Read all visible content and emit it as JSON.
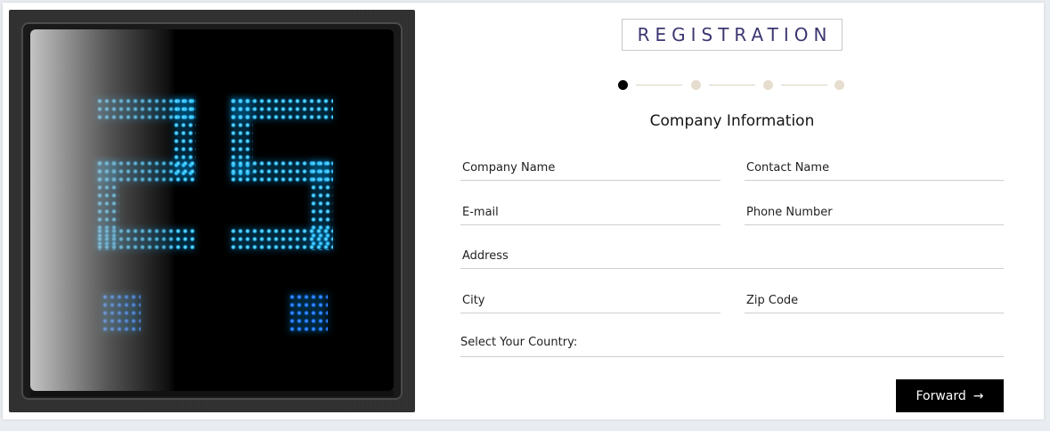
{
  "image": {
    "description_icon": "led-display-image",
    "digits_shown": "25"
  },
  "header": {
    "title": "REGISTRATION"
  },
  "stepper": {
    "total_steps": 4,
    "current_step": 1,
    "active_color": "#000000",
    "inactive_color": "#e6ddcf"
  },
  "section": {
    "title": "Company Information"
  },
  "form": {
    "company_name": {
      "placeholder": "Company Name",
      "value": ""
    },
    "contact_name": {
      "placeholder": "Contact Name",
      "value": ""
    },
    "email": {
      "placeholder": "E-mail",
      "value": ""
    },
    "phone": {
      "placeholder": "Phone Number",
      "value": ""
    },
    "address": {
      "placeholder": "Address",
      "value": ""
    },
    "city": {
      "placeholder": "City",
      "value": ""
    },
    "zip": {
      "placeholder": "Zip Code",
      "value": ""
    },
    "country_label": "Select Your Country:"
  },
  "actions": {
    "forward_label": "Forward",
    "forward_icon": "arrow-right-icon",
    "forward_glyph": "→"
  }
}
